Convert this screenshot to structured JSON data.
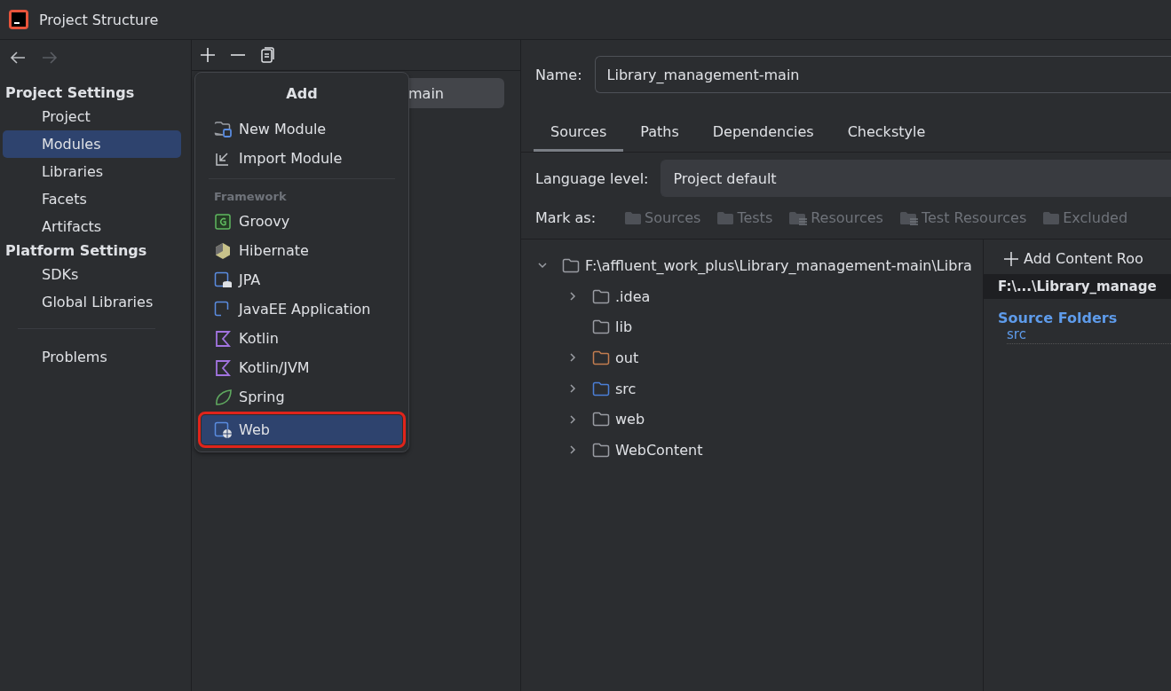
{
  "window": {
    "title": "Project Structure"
  },
  "sidebar": {
    "groups": [
      {
        "heading": "Project Settings",
        "items": [
          {
            "label": "Project",
            "selected": false
          },
          {
            "label": "Modules",
            "selected": true
          },
          {
            "label": "Libraries",
            "selected": false
          },
          {
            "label": "Facets",
            "selected": false
          },
          {
            "label": "Artifacts",
            "selected": false
          }
        ]
      },
      {
        "heading": "Platform Settings",
        "items": [
          {
            "label": "SDKs",
            "selected": false
          },
          {
            "label": "Global Libraries",
            "selected": false
          }
        ]
      }
    ],
    "extra_items": [
      {
        "label": "Problems",
        "selected": false
      }
    ]
  },
  "modules": {
    "items": [
      {
        "label": "main",
        "selected": true
      }
    ]
  },
  "add_popup": {
    "title": "Add",
    "sections": [
      {
        "items": [
          {
            "label": "New Module",
            "kind": "module",
            "selected": false,
            "highlighted": false
          },
          {
            "label": "Import Module",
            "kind": "import",
            "selected": false,
            "highlighted": false
          }
        ]
      },
      {
        "heading": "Framework",
        "items": [
          {
            "label": "Groovy",
            "kind": "groovy",
            "selected": false,
            "highlighted": false
          },
          {
            "label": "Hibernate",
            "kind": "hibernate",
            "selected": false,
            "highlighted": false
          },
          {
            "label": "JPA",
            "kind": "jpa",
            "selected": false,
            "highlighted": false
          },
          {
            "label": "JavaEE Application",
            "kind": "javaee",
            "selected": false,
            "highlighted": false
          },
          {
            "label": "Kotlin",
            "kind": "kotlin",
            "selected": false,
            "highlighted": false
          },
          {
            "label": "Kotlin/JVM",
            "kind": "kotlin",
            "selected": false,
            "highlighted": false
          },
          {
            "label": "Spring",
            "kind": "spring",
            "selected": false,
            "highlighted": false
          },
          {
            "label": "Web",
            "kind": "web",
            "selected": true,
            "highlighted": true
          }
        ]
      }
    ]
  },
  "module_settings": {
    "name_label": "Name:",
    "name_value": "Library_management-main",
    "tabs": [
      {
        "label": "Sources",
        "selected": true
      },
      {
        "label": "Paths",
        "selected": false
      },
      {
        "label": "Dependencies",
        "selected": false
      },
      {
        "label": "Checkstyle",
        "selected": false
      }
    ],
    "language_level_label": "Language level:",
    "language_level_value": "Project default",
    "mark_as_label": "Mark as:",
    "mark_as": [
      {
        "label": "Sources",
        "disabled": true
      },
      {
        "label": "Tests",
        "disabled": true
      },
      {
        "label": "Resources",
        "disabled": true
      },
      {
        "label": "Test Resources",
        "disabled": true
      },
      {
        "label": "Excluded",
        "disabled": true
      }
    ],
    "tree": [
      {
        "label": "F:\\affluent_work_plus\\Library_management-main\\Libra",
        "expanded": true,
        "color": "#9a9da3",
        "children": [
          {
            "label": ".idea",
            "expanded": false,
            "color": "#9a9da3"
          },
          {
            "label": "lib",
            "color": "#9a9da3"
          },
          {
            "label": "out",
            "expanded": false,
            "color": "#c27d4f"
          },
          {
            "label": "src",
            "expanded": false,
            "color": "#4b7fd6"
          },
          {
            "label": "web",
            "expanded": false,
            "color": "#9a9da3"
          },
          {
            "label": "WebContent",
            "expanded": false,
            "color": "#9a9da3"
          }
        ]
      }
    ],
    "content_root": {
      "add_label": "Add Content Roo",
      "root_path": "F:\\...\\Library_manage",
      "source_folders_heading": "Source Folders",
      "source_folders": [
        "src"
      ]
    }
  }
}
